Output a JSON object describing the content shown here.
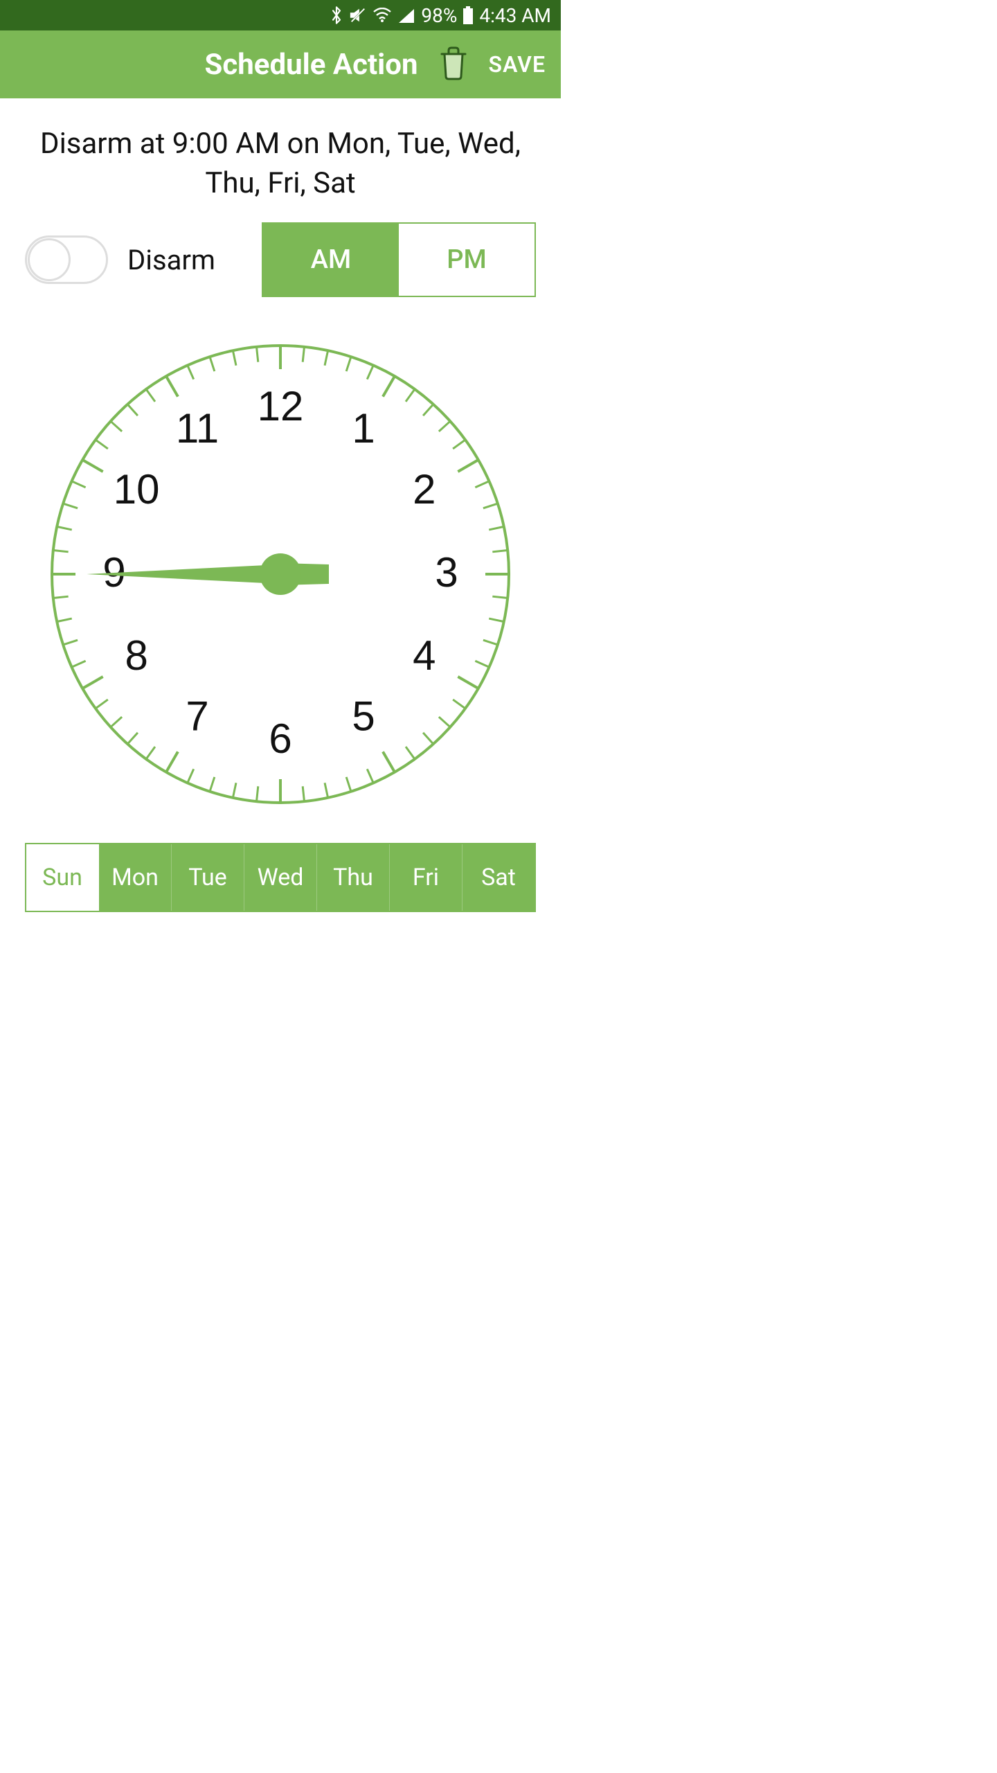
{
  "colors": {
    "accent": "#7cb855",
    "statusbar": "#32691e"
  },
  "status_bar": {
    "battery_percent": "98%",
    "time": "4:43 AM"
  },
  "app_bar": {
    "title": "Schedule Action",
    "save_label": "SAVE"
  },
  "summary": "Disarm at 9:00 AM on Mon, Tue, Wed, Thu, Fri, Sat",
  "arm_toggle": {
    "on": false,
    "label": "Disarm"
  },
  "ampm": {
    "am": "AM",
    "pm": "PM",
    "selected": "AM"
  },
  "clock": {
    "hour": 9,
    "minute": 0,
    "numbers": [
      "12",
      "1",
      "2",
      "3",
      "4",
      "5",
      "6",
      "7",
      "8",
      "9",
      "10",
      "11"
    ]
  },
  "days": [
    {
      "label": "Sun",
      "selected": false
    },
    {
      "label": "Mon",
      "selected": true
    },
    {
      "label": "Tue",
      "selected": true
    },
    {
      "label": "Wed",
      "selected": true
    },
    {
      "label": "Thu",
      "selected": true
    },
    {
      "label": "Fri",
      "selected": true
    },
    {
      "label": "Sat",
      "selected": true
    }
  ]
}
